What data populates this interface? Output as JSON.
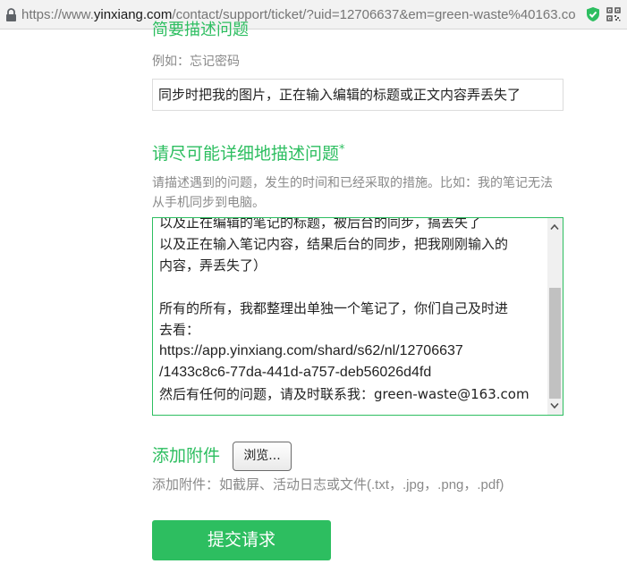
{
  "browser": {
    "url_prefix": "https://www.",
    "url_host": "yinxiang.com",
    "url_rest": "/contact/support/ticket/?uid=12706637&em=green-waste%40163.co"
  },
  "form": {
    "subject": {
      "heading": "简要描述问题",
      "hint": "例如：忘记密码",
      "value": "同步时把我的图片，正在输入编辑的标题或正文内容弄丢失了"
    },
    "description": {
      "heading": "请尽可能详细地描述问题",
      "required_mark": "*",
      "hint": "请描述遇到的问题，发生的时间和已经采取的措施。比如：我的笔记无法从手机同步到电脑。",
      "lines": [
        "以及正在编辑的笔记的标题，被后台的同步，搞丢失了",
        "以及正在输入笔记内容，结果后台的同步，把我刚刚输入的",
        "内容，弄丢失了）",
        "",
        "所有的所有，我都整理出单独一个笔记了，你们自己及时进",
        "去看：",
        "https://app.yinxiang.com/shard/s62/nl/12706637",
        "/1433c8c6-77da-441d-a757-deb56026d4fd",
        "然后有任何的问题，请及时联系我：green-waste@163.com"
      ]
    },
    "attachment": {
      "label": "添加附件",
      "browse_label": "浏览...",
      "hint": "添加附件：如截屏、活动日志或文件(.txt，.jpg，.png，.pdf)"
    },
    "submit_label": "提交请求"
  },
  "icons": {
    "lock": "lock-icon",
    "shield": "shield-check-icon",
    "qr": "qr-code-icon"
  },
  "colors": {
    "accent": "#2dbe60",
    "hint": "#8a8a8a"
  }
}
